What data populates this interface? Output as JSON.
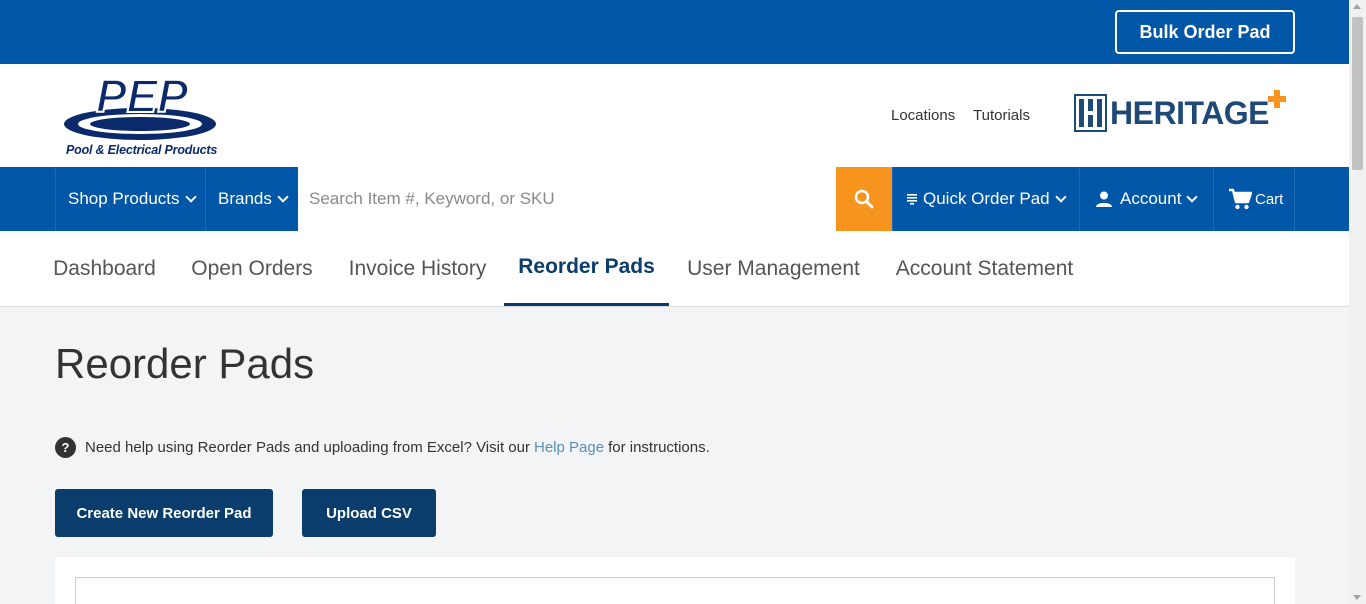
{
  "topbar": {
    "bulk_order_label": "Bulk Order Pad"
  },
  "header": {
    "logo_text": "PEP",
    "logo_caption": "Pool & Electrical Products",
    "links": [
      "Locations",
      "Tutorials"
    ],
    "partner_logo_text": "HERITAGE"
  },
  "nav": {
    "shop_products": "Shop Products",
    "brands": "Brands",
    "search_placeholder": "Search Item #, Keyword, or SKU",
    "quick_order_pad": "Quick Order Pad",
    "account": "Account",
    "cart": "Cart"
  },
  "tabs": [
    "Dashboard",
    "Open Orders",
    "Invoice History",
    "Reorder Pads",
    "User Management",
    "Account Statement"
  ],
  "active_tab": "Reorder Pads",
  "main": {
    "title": "Reorder Pads",
    "help_icon_glyph": "?",
    "help_prefix": "Need help using Reorder Pads and uploading from Excel? Visit our",
    "help_link": "Help Page",
    "help_suffix": "for instructions.",
    "create_button": "Create New Reorder Pad",
    "upload_button": "Upload CSV"
  },
  "colors": {
    "brand_blue": "#0056a7",
    "navy": "#0a3d6b",
    "accent_orange": "#f7941d"
  },
  "icons": {
    "search": "search-icon",
    "quick_order": "list-icon",
    "account": "user-icon",
    "cart": "cart-icon",
    "help": "help-icon"
  }
}
